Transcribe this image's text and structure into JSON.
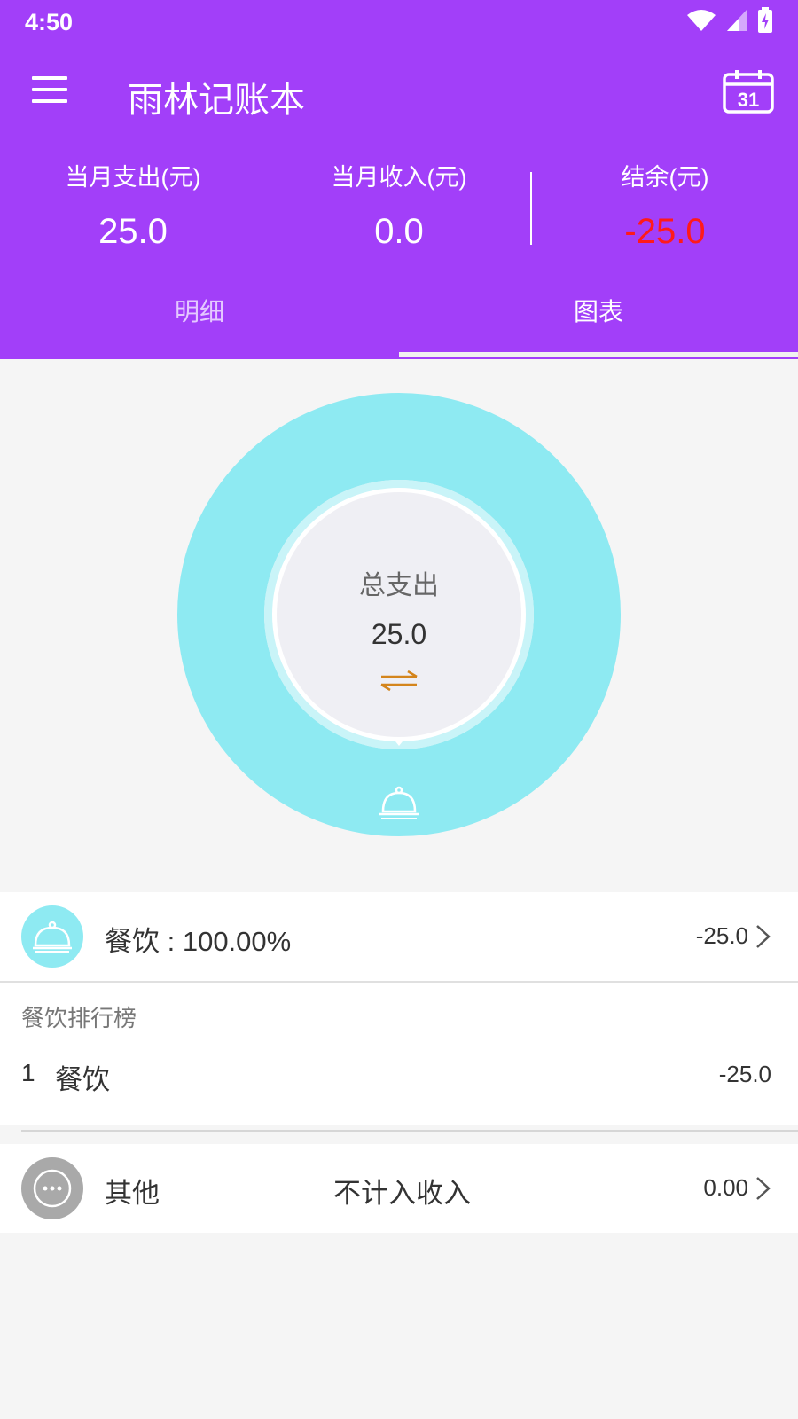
{
  "status": {
    "time": "4:50"
  },
  "app": {
    "title": "雨林记账本"
  },
  "summary": {
    "expense_label": "当月支出(元)",
    "expense_value": "25.0",
    "income_label": "当月收入(元)",
    "income_value": "0.0",
    "balance_label": "结余(元)",
    "balance_value": "-25.0"
  },
  "tabs": [
    {
      "label": "明细"
    },
    {
      "label": "图表"
    }
  ],
  "chart_data": {
    "type": "pie",
    "title": "总支出",
    "total": "25.0",
    "slices": [
      {
        "name": "餐饮",
        "value": 25.0,
        "percent": 100.0,
        "color": "#8eeaf2"
      }
    ]
  },
  "category_row": {
    "label": "餐饮 : 100.00%",
    "amount": "-25.0",
    "icon": "cloche-icon",
    "color": "#8eeaf2"
  },
  "ranking": {
    "title": "餐饮排行榜",
    "items": [
      {
        "rank": "1",
        "name": "餐饮",
        "amount": "-25.0"
      }
    ]
  },
  "other_row": {
    "label": "其他",
    "note": "不计入收入",
    "amount": "0.00",
    "icon": "more-dots-icon",
    "color": "#a9a9a9"
  },
  "colors": {
    "header": "#a23ff9",
    "negative": "#ff1a1a",
    "accent_swap": "#d4851c"
  }
}
